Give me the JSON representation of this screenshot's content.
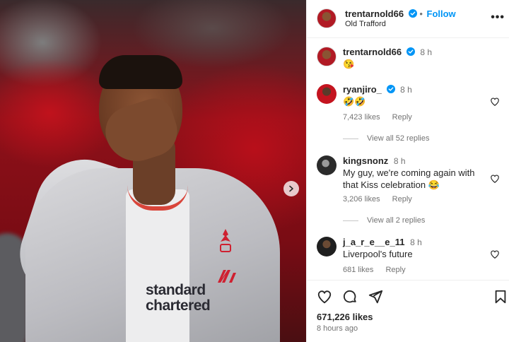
{
  "post": {
    "username": "trentarnold66",
    "follow_label": "Follow",
    "location": "Old Trafford",
    "caption_username": "trentarnold66",
    "caption_time": "8 h",
    "caption_text": "😘",
    "likes": "671,226 likes",
    "posted_ago": "8 hours ago",
    "photo_sponsor_text": "standard\nchartered"
  },
  "comments": [
    {
      "username": "ryanjiro_",
      "verified": true,
      "time": "8 h",
      "text": "🤣🤣",
      "likes": "7,423 likes",
      "reply_label": "Reply",
      "view_replies": "View all 52 replies"
    },
    {
      "username": "kingsnonz",
      "verified": false,
      "time": "8 h",
      "text": "My guy, we're coming again with that Kiss celebration 😂",
      "likes": "3,206 likes",
      "reply_label": "Reply",
      "view_replies": "View all 2 replies"
    },
    {
      "username": "j_a_r_e__e_11",
      "verified": false,
      "time": "8 h",
      "text": "Liverpool's future",
      "likes": "681 likes",
      "reply_label": "Reply"
    }
  ],
  "icons": {
    "verified": "verified-badge-icon",
    "more": "more-options-icon",
    "next": "chevron-right-icon",
    "like": "heart-icon",
    "comment": "comment-icon",
    "share": "send-icon",
    "save": "bookmark-icon"
  },
  "colors": {
    "accent": "#0095f6",
    "text": "#262626",
    "muted": "#737373",
    "divider": "#efefef"
  }
}
